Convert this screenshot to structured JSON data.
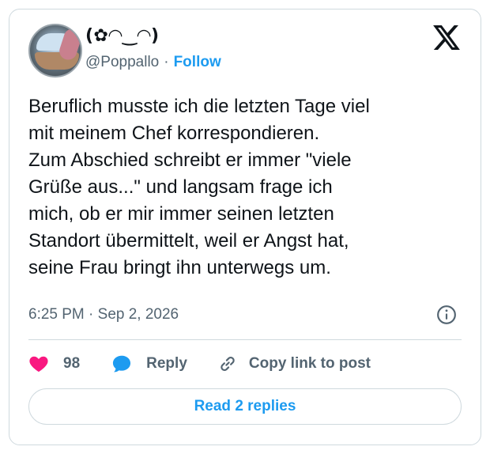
{
  "author": {
    "display_name": "(✿◠‿◠)",
    "handle": "@Poppallo",
    "separator": "·",
    "follow_label": "Follow"
  },
  "tweet": {
    "text": "Beruflich musste ich die letzten Tage viel\nmit meinem Chef korrespondieren.\nZum Abschied schreibt er immer \"viele\nGrüße aus...\" und langsam frage ich\nmich, ob er mir immer seinen letzten\nStandort übermittelt, weil er Angst hat,\nseine Frau bringt ihn unterwegs um.",
    "timestamp": "6:25 PM · Sep 2, 2026"
  },
  "actions": {
    "like_count": "98",
    "reply_label": "Reply",
    "copy_label": "Copy link to post"
  },
  "footer": {
    "read_replies_label": "Read 2 replies"
  },
  "icons": {
    "logo": "x-logo-icon",
    "info": "info-icon",
    "like": "heart-icon",
    "reply": "speech-bubble-icon",
    "copy": "link-icon"
  },
  "colors": {
    "accent": "#1d9bf0",
    "like": "#f91880",
    "text": "#0f1419",
    "muted": "#536471",
    "border": "#cfd9de"
  }
}
